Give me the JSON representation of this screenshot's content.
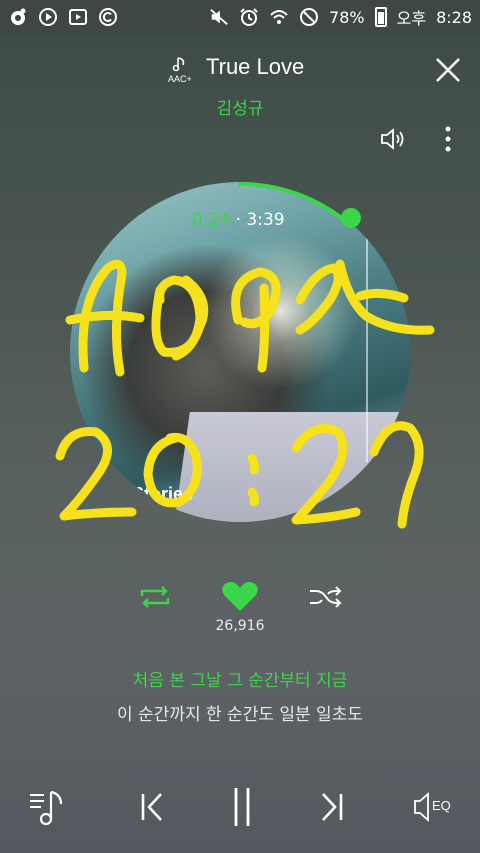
{
  "status_bar": {
    "battery_percent": "78%",
    "period": "오후",
    "time": "8:28",
    "icons_left": [
      "record-icon",
      "play-circle-icon",
      "youtube-icon",
      "copyright-icon"
    ],
    "icons_right": [
      "mute-icon",
      "alarm-icon",
      "wifi-icon",
      "do-not-disturb-icon",
      "battery-icon"
    ]
  },
  "header": {
    "codec_badge": "AAC+",
    "title": "True Love",
    "artist": "김성규"
  },
  "player": {
    "elapsed": "0:24",
    "separator": "·",
    "duration": "3:39",
    "album_caption": "Stories",
    "progress_fraction": 0.11
  },
  "actions": {
    "like_count": "26,916"
  },
  "lyrics": {
    "current": "처음 본 그날 그 순간부터 지금",
    "next": "이 순간까지 한 순간도 일분 일초도"
  },
  "controls": {
    "eq_label": "EQ"
  },
  "colors": {
    "accent": "#3cd64b",
    "scribble": "#f5e11c"
  }
}
